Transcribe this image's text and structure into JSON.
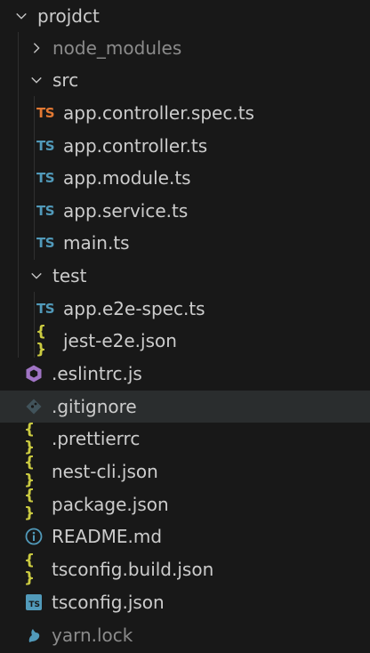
{
  "explorer": {
    "root": {
      "label": "projdct",
      "expanded": true
    },
    "folders": {
      "node_modules": {
        "label": "node_modules",
        "expanded": false
      },
      "src": {
        "label": "src",
        "expanded": true
      },
      "test": {
        "label": "test",
        "expanded": true
      }
    },
    "src_files": [
      {
        "label": "app.controller.spec.ts",
        "icon": "typescript-spec-icon",
        "badge": "TS",
        "color": "#e37933"
      },
      {
        "label": "app.controller.ts",
        "icon": "typescript-icon",
        "badge": "TS",
        "color": "#519aba"
      },
      {
        "label": "app.module.ts",
        "icon": "typescript-icon",
        "badge": "TS",
        "color": "#519aba"
      },
      {
        "label": "app.service.ts",
        "icon": "typescript-icon",
        "badge": "TS",
        "color": "#519aba"
      },
      {
        "label": "main.ts",
        "icon": "typescript-icon",
        "badge": "TS",
        "color": "#519aba"
      }
    ],
    "test_files": [
      {
        "label": "app.e2e-spec.ts",
        "icon": "typescript-icon",
        "badge": "TS",
        "color": "#519aba"
      },
      {
        "label": "jest-e2e.json",
        "icon": "json-icon",
        "badge": "{ }",
        "color": "#cbcb41"
      }
    ],
    "root_files": [
      {
        "label": ".eslintrc.js",
        "icon": "eslint-icon",
        "color": "#a074c4"
      },
      {
        "label": ".gitignore",
        "icon": "git-icon",
        "color": "#41535b",
        "selected": true
      },
      {
        "label": ".prettierrc",
        "icon": "json-icon",
        "badge": "{ }",
        "color": "#cbcb41"
      },
      {
        "label": "nest-cli.json",
        "icon": "json-icon",
        "badge": "{ }",
        "color": "#cbcb41"
      },
      {
        "label": "package.json",
        "icon": "json-icon",
        "badge": "{ }",
        "color": "#cbcb41"
      },
      {
        "label": "README.md",
        "icon": "info-icon",
        "color": "#519aba"
      },
      {
        "label": "tsconfig.build.json",
        "icon": "json-icon",
        "badge": "{ }",
        "color": "#cbcb41"
      },
      {
        "label": "tsconfig.json",
        "icon": "tsconfig-icon",
        "badge": "TS",
        "color": "#519aba"
      },
      {
        "label": "yarn.lock",
        "icon": "yarn-icon",
        "color": "#519aba",
        "dim": true
      }
    ]
  }
}
